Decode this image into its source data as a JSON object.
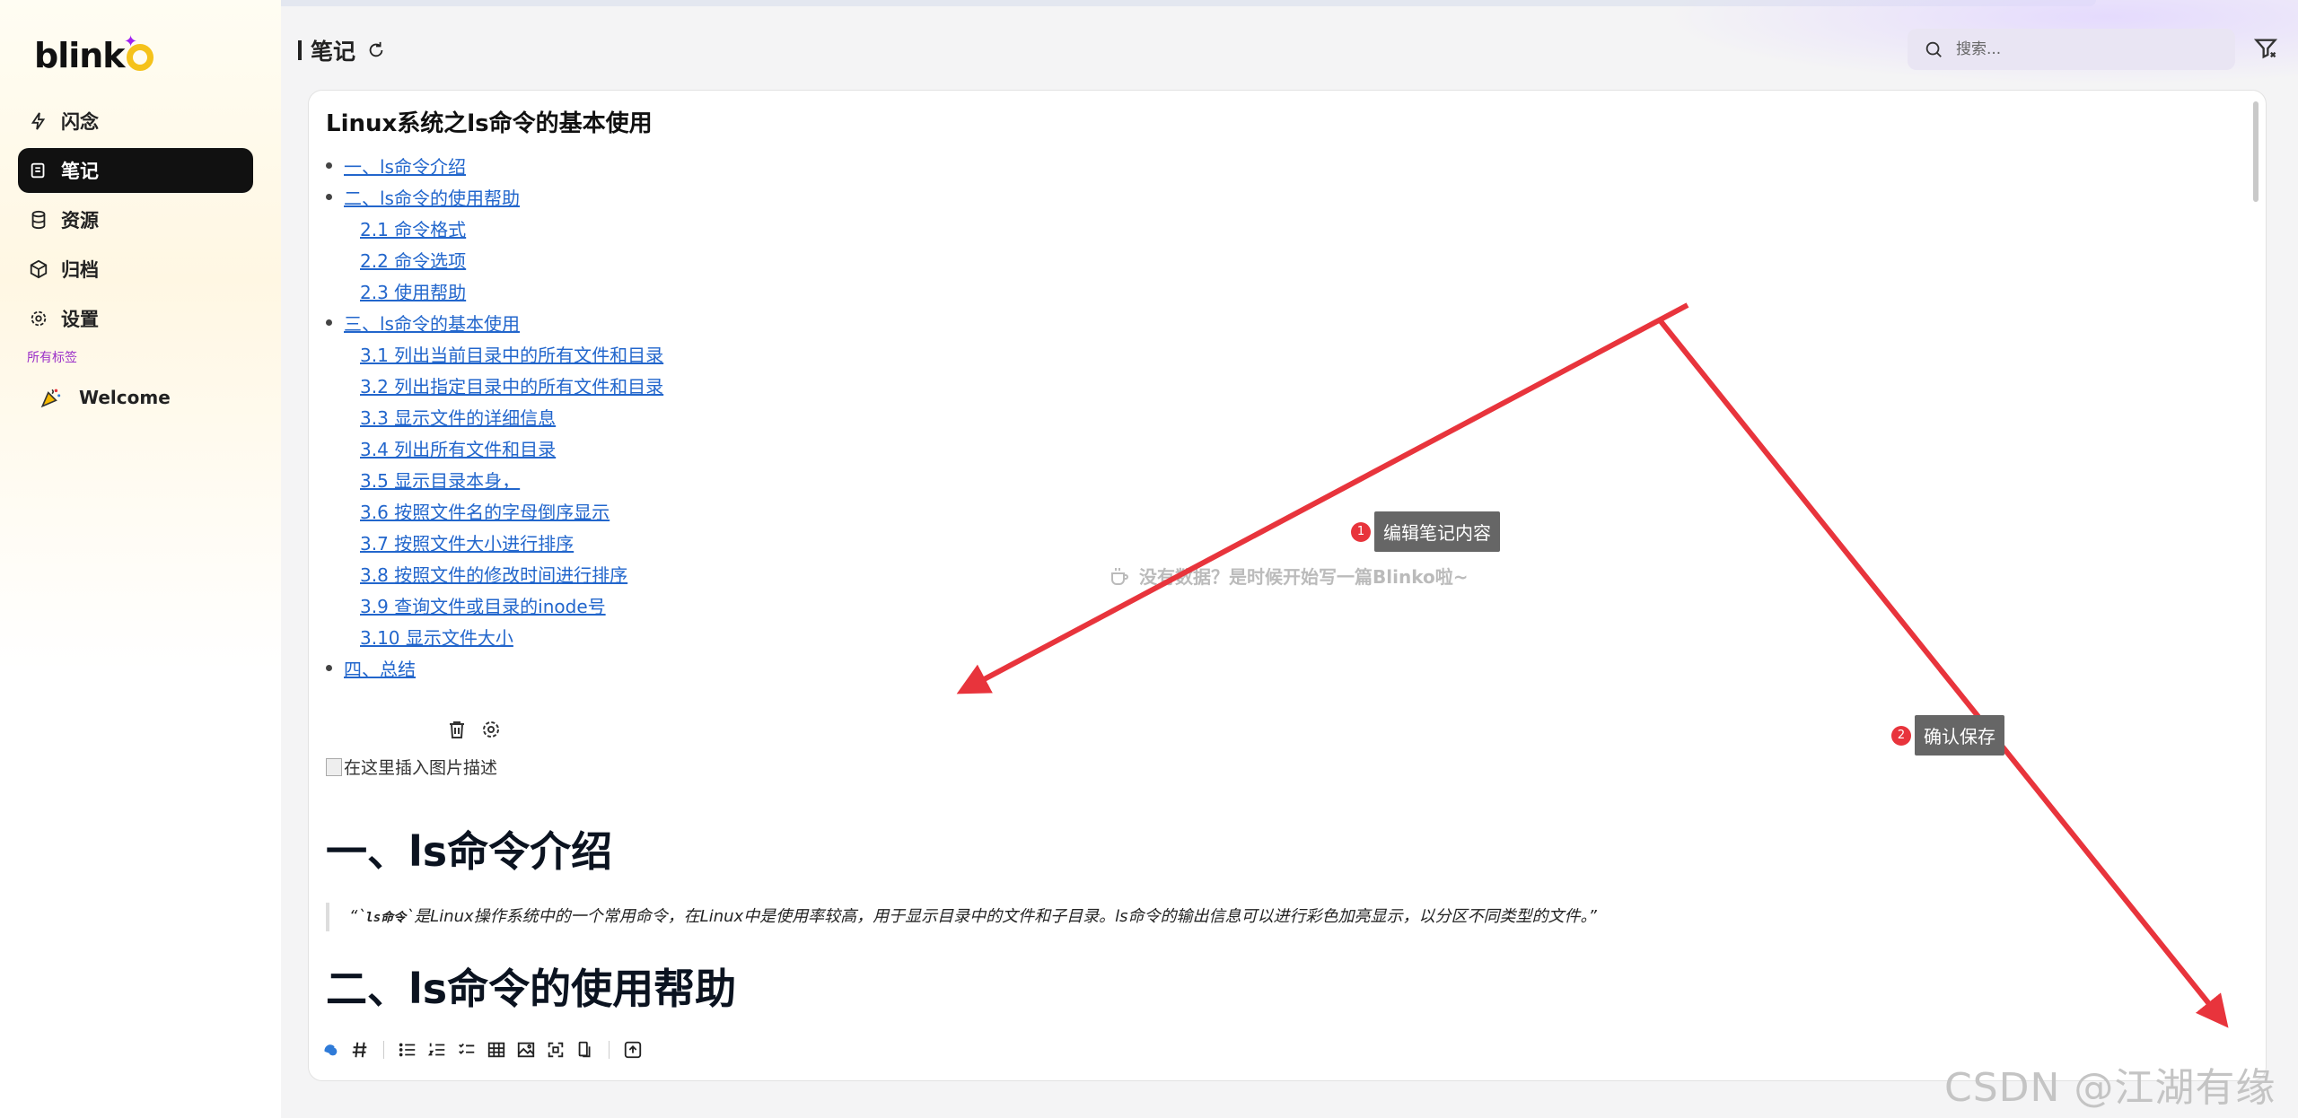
{
  "app": {
    "logo": "blink"
  },
  "sidebar": {
    "items": [
      {
        "label": "闪念",
        "icon": "lightning-icon",
        "active": false
      },
      {
        "label": "笔记",
        "icon": "notes-icon",
        "active": true
      },
      {
        "label": "资源",
        "icon": "database-icon",
        "active": false
      },
      {
        "label": "归档",
        "icon": "box-icon",
        "active": false
      },
      {
        "label": "设置",
        "icon": "gear-icon",
        "active": false
      }
    ],
    "tags_title": "所有标签",
    "tags": [
      {
        "label": "Welcome",
        "icon": "party-popper-icon"
      }
    ]
  },
  "header": {
    "title": "笔记",
    "search_placeholder": "搜索..."
  },
  "empty_state": "没有数据？是时候开始写一篇Blinko啦~",
  "editor": {
    "doc_title": "Linux系统之ls命令的基本使用",
    "toc": [
      {
        "text": "一、ls命令介绍",
        "level": 1
      },
      {
        "text": "二、ls命令的使用帮助",
        "level": 1
      },
      {
        "text": "2.1 命令格式",
        "level": 2
      },
      {
        "text": "2.2 命令选项",
        "level": 2
      },
      {
        "text": "2.3 使用帮助",
        "level": 2
      },
      {
        "text": "三、ls命令的基本使用",
        "level": 1
      },
      {
        "text": "3.1 列出当前目录中的所有文件和目录",
        "level": 2
      },
      {
        "text": "3.2 列出指定目录中的所有文件和目录",
        "level": 2
      },
      {
        "text": "3.3 显示文件的详细信息",
        "level": 2
      },
      {
        "text": "3.4 列出所有文件和目录",
        "level": 2
      },
      {
        "text": "3.5 显示目录本身，",
        "level": 2
      },
      {
        "text": "3.6 按照文件名的字母倒序显示",
        "level": 2
      },
      {
        "text": "3.7 按照文件大小进行排序",
        "level": 2
      },
      {
        "text": "3.8 按照文件的修改时间进行排序",
        "level": 2
      },
      {
        "text": "3.9 查询文件或目录的inode号",
        "level": 2
      },
      {
        "text": "3.10 显示文件大小",
        "level": 2
      },
      {
        "text": "四、总结",
        "level": 1
      }
    ],
    "image_alt": "在这里插入图片描述",
    "heading1": "一、ls命令介绍",
    "quote_prefix": "“`",
    "quote_code": "ls命令",
    "quote_text": "`是Linux操作系统中的一个常用命令，在Linux中是使用率较高，用于显示目录中的文件和子目录。ls命令的输出信息可以进行彩色加亮显示，以分区不同类型的文件。”",
    "heading2": "二、ls命令的使用帮助"
  },
  "annotations": [
    {
      "num": "1",
      "label": "编辑笔记内容"
    },
    {
      "num": "2",
      "label": "确认保存"
    }
  ],
  "watermark": "CSDN @江湖有缘",
  "colors": {
    "accent": "#111111",
    "link": "#2266cc",
    "annotation": "#e8343c",
    "tag_title": "#9b30c8"
  }
}
